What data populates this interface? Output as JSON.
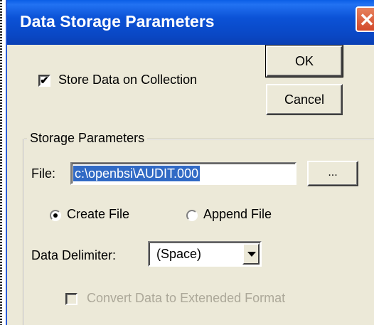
{
  "window": {
    "title": "Data Storage Parameters",
    "close_glyph": "✕"
  },
  "buttons": {
    "ok": "OK",
    "cancel": "Cancel",
    "browse": "..."
  },
  "store_checkbox": {
    "label": "Store Data on Collection",
    "checked": true,
    "check_glyph": "✔"
  },
  "group": {
    "title": "Storage Parameters"
  },
  "file": {
    "label": "File:",
    "value": "c:\\openbsi\\AUDIT.000"
  },
  "mode": {
    "create_label": "Create File",
    "append_label": "Append File",
    "selected": "create"
  },
  "delimiter": {
    "label": "Data Delimiter:",
    "selected": "(Space)"
  },
  "convert_checkbox": {
    "label": "Convert Data to Exteneded Format",
    "checked": false,
    "enabled": false
  },
  "colors": {
    "titlebar": "#0a52d6",
    "close_button": "#d2492b",
    "dialog_face": "#ece9d8",
    "selection": "#316ac5",
    "disabled_text": "#aca899"
  }
}
